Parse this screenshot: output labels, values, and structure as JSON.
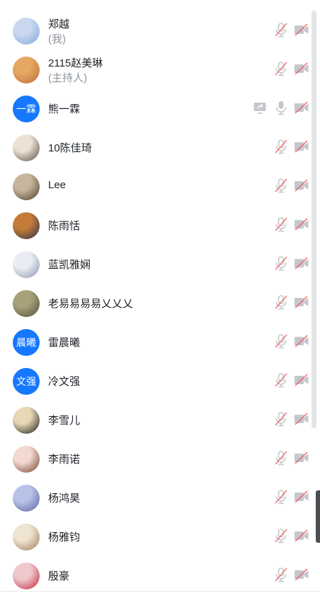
{
  "participants": [
    {
      "name": "郑越",
      "subtitle": "(我)",
      "avatar_type": "image",
      "avatar_colors": [
        "#c9d8ef",
        "#7fa6d9"
      ],
      "share": false
    },
    {
      "name": "2115赵美琳",
      "subtitle": "(主持人)",
      "avatar_type": "image",
      "avatar_colors": [
        "#e6a763",
        "#b96c3a"
      ],
      "share": false
    },
    {
      "name": "熊一霖",
      "subtitle": "",
      "avatar_type": "text",
      "avatar_text": "一霖",
      "share": true
    },
    {
      "name": "10陈佳琦",
      "subtitle": "",
      "avatar_type": "image",
      "avatar_colors": [
        "#ece2d4",
        "#5a4a40"
      ],
      "share": false
    },
    {
      "name": "Lee",
      "subtitle": "",
      "avatar_type": "image",
      "avatar_colors": [
        "#c6b69d",
        "#4b3a2a"
      ],
      "share": false
    },
    {
      "name": "陈雨恬",
      "subtitle": "",
      "avatar_type": "image",
      "avatar_colors": [
        "#c57c3a",
        "#2a2f45"
      ],
      "share": false
    },
    {
      "name": "蓝凯雅娴",
      "subtitle": "",
      "avatar_type": "image",
      "avatar_colors": [
        "#e9edf3",
        "#8a96b0"
      ],
      "share": false
    },
    {
      "name": "老易易易易乂乂乂",
      "subtitle": "",
      "avatar_type": "image",
      "avatar_colors": [
        "#a7a27a",
        "#4e4a36"
      ],
      "share": false
    },
    {
      "name": "雷晨曦",
      "subtitle": "",
      "avatar_type": "text",
      "avatar_text": "晨曦",
      "share": false
    },
    {
      "name": "冷文强",
      "subtitle": "",
      "avatar_type": "text",
      "avatar_text": "文强",
      "share": false
    },
    {
      "name": "李雪儿",
      "subtitle": "",
      "avatar_type": "image",
      "avatar_colors": [
        "#e8d8b5",
        "#141414"
      ],
      "share": false
    },
    {
      "name": "李雨诺",
      "subtitle": "",
      "avatar_type": "image",
      "avatar_colors": [
        "#f3d9cf",
        "#6e3d32"
      ],
      "share": false
    },
    {
      "name": "杨鸿昊",
      "subtitle": "",
      "avatar_type": "image",
      "avatar_colors": [
        "#b9c3e8",
        "#5a5f9e"
      ],
      "share": false
    },
    {
      "name": "杨雅钧",
      "subtitle": "",
      "avatar_type": "image",
      "avatar_colors": [
        "#efe4d2",
        "#9d7a56"
      ],
      "share": false
    },
    {
      "name": "殷豪",
      "subtitle": "",
      "avatar_type": "image",
      "avatar_colors": [
        "#f0c8cc",
        "#c0233a"
      ],
      "share": false
    }
  ],
  "icons": {
    "mic": "microphone-muted-icon",
    "camera": "camera-off-icon",
    "share": "screen-share-icon"
  },
  "colors": {
    "accent": "#1677ff",
    "muted_slash": "#f25c5c",
    "icon_gray": "#c4c7cc",
    "subtitle": "#8f959e"
  }
}
